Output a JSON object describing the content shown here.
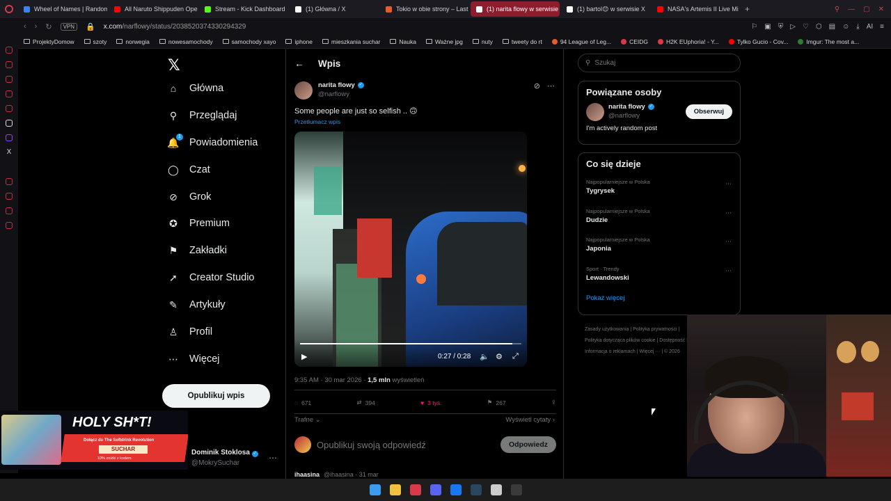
{
  "browser": {
    "tabs": [
      {
        "label": "Wheel of Names | Random",
        "color": "#3b82f6",
        "active": false
      },
      {
        "label": "All Naruto Shippuden Ope",
        "color": "#ff0000",
        "active": false
      },
      {
        "label": "Stream - Kick Dashboard",
        "color": "#53fc18",
        "active": false
      },
      {
        "label": "(1) Główna / X",
        "color": "#ffffff",
        "active": false
      },
      {
        "label": "Tokio w obie strony – Last",
        "color": "#e85b2c",
        "active": false
      },
      {
        "label": "(1) narita flowy w serwisie",
        "color": "#ffffff",
        "active": true
      },
      {
        "label": "(1) bartol😊 w serwisie X",
        "color": "#ffffff",
        "active": false
      },
      {
        "label": "NASA's Artemis II Live Mi",
        "color": "#ff0000",
        "active": false
      }
    ],
    "url_host": "x.com",
    "url_path": "/narflowy/status/2038520374330294329",
    "vpn_label": "VPN",
    "bookmarks": [
      "ProjektyDomow",
      "szoty",
      "norwegia",
      "nowesamochody",
      "samochody xayo",
      "iphone",
      "mieszkania suchar",
      "Nauka",
      "Ważne jpg",
      "nuty",
      "tweety do rt",
      "94 League of Leg...",
      "CEIDG",
      "H2K EUphoria! - Y...",
      "Tylko Gucio - Cov...",
      "Imgur: The most a..."
    ],
    "addr_icons_label": "AI"
  },
  "x": {
    "nav": [
      {
        "label": "Główna",
        "icon": "home-icon",
        "glyph": "⌂"
      },
      {
        "label": "Przeglądaj",
        "icon": "search-icon",
        "glyph": "⚲"
      },
      {
        "label": "Powiadomienia",
        "icon": "bell-icon",
        "glyph": "🔔",
        "badge": "1"
      },
      {
        "label": "Czat",
        "icon": "chat-icon",
        "glyph": "◯"
      },
      {
        "label": "Grok",
        "icon": "grok-icon",
        "glyph": "⊘"
      },
      {
        "label": "Premium",
        "icon": "premium-icon",
        "glyph": "✪"
      },
      {
        "label": "Zakładki",
        "icon": "bookmark-icon",
        "glyph": "⚑"
      },
      {
        "label": "Creator Studio",
        "icon": "rocket-icon",
        "glyph": "➚"
      },
      {
        "label": "Artykuły",
        "icon": "article-icon",
        "glyph": "✎"
      },
      {
        "label": "Profil",
        "icon": "profile-icon",
        "glyph": "♙"
      },
      {
        "label": "Więcej",
        "icon": "more-icon",
        "glyph": "⋯"
      }
    ],
    "publish_label": "Opublikuj wpis",
    "account": {
      "name": "Dominik Stoklosa",
      "handle": "@MokrySuchar"
    },
    "post": {
      "header_title": "Wpis",
      "author_name": "narita flowy",
      "author_handle": "@narflowy",
      "text": "Some people are just so selfish .. 🙃",
      "translate_label": "Przetłumacz wpis",
      "video_time": "0:27 / 0:28",
      "video_progress": 0.96,
      "timestamp": "9:35 AM · 30 mar 2026 · ",
      "views_count": "1,5 mln",
      "views_label": " wyświetleń",
      "replies": "671",
      "reposts": "394",
      "likes": "3 tys.",
      "bookmarks": "267",
      "sort_label": "Trafne",
      "quotes_label": "Wyświetl cytaty ›",
      "reply_placeholder": "Opublikuj swoją odpowiedź",
      "reply_button": "Odpowiedz",
      "next_author": "ihaasina",
      "next_meta": "@ihaasina · 31 mar"
    },
    "search_placeholder": "Szukaj",
    "related": {
      "title": "Powiązane osoby",
      "name": "narita flowy",
      "handle": "@narflowy",
      "bio": "I'm actively random post",
      "follow_label": "Obserwuj"
    },
    "trending": {
      "title": "Co się dzieje",
      "items": [
        {
          "context": "Najpopularniejsze w Polska",
          "name": "Tygrysek"
        },
        {
          "context": "Najpopularniejsze w Polska",
          "name": "Dudzie"
        },
        {
          "context": "Najpopularniejsze w Polska",
          "name": "Japonia"
        },
        {
          "context": "Sport · Trendy",
          "name": "Lewandowski"
        }
      ],
      "show_more": "Pokaż więcej"
    },
    "footer": [
      "Zasady użytkowania",
      "Polityka prywatności",
      "Polityka dotycząca plików cookie",
      "Dostępność",
      "Informacja o reklamach",
      "Więcej ···",
      "© 2026"
    ]
  },
  "ad": {
    "headline": "HOLY SH*T!",
    "line1": "Dołącz do The Softdrink Revolution",
    "brand": "SUCHAR",
    "line2": "10% zniżki z kodem"
  },
  "taskbar": {
    "apps": [
      {
        "name": "windows-start-icon",
        "color": "#3b9cf0"
      },
      {
        "name": "file-explorer-icon",
        "color": "#f0c040"
      },
      {
        "name": "opera-icon",
        "color": "#d83a4a"
      },
      {
        "name": "discord-icon",
        "color": "#5865f2"
      },
      {
        "name": "facebook-icon",
        "color": "#1877f2"
      },
      {
        "name": "steam-icon",
        "color": "#2a475e"
      },
      {
        "name": "opera-gx-icon",
        "color": "#cccccc"
      },
      {
        "name": "terminal-icon",
        "color": "#3a3a3a"
      }
    ]
  }
}
